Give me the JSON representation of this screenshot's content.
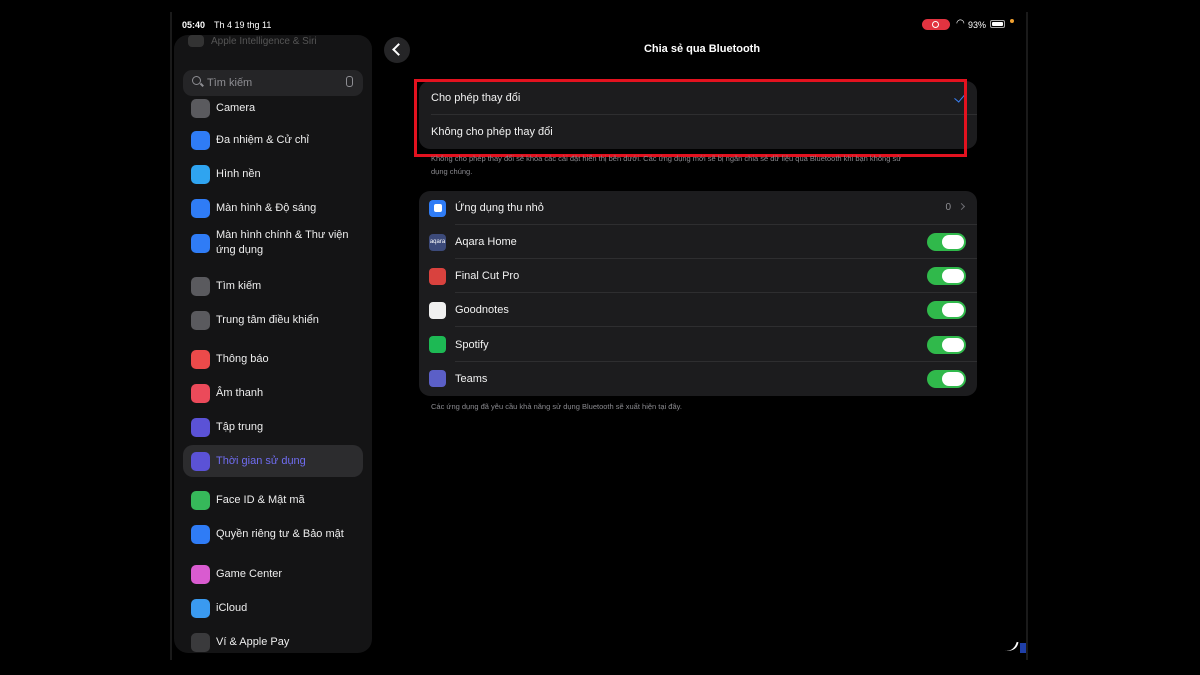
{
  "status_bar": {
    "time": "05:40",
    "date": "Th 4 19 thg 11",
    "battery": "93%"
  },
  "sidebar": {
    "faded_top": "Apple Intelligence & Siri",
    "search_placeholder": "Tìm kiếm",
    "items": [
      {
        "label": "Camera",
        "icon": "camera-icon",
        "color": "#5a5a5e"
      },
      {
        "label": "Đa nhiệm & Cử chỉ",
        "icon": "multitasking-icon",
        "color": "#2f7cf6"
      },
      {
        "label": "Hình nền",
        "icon": "wallpaper-icon",
        "color": "#2fa4f0"
      },
      {
        "label": "Màn hình & Độ sáng",
        "icon": "display-icon",
        "color": "#2f7cf6"
      },
      {
        "label": "Màn hình chính & Thư viện ứng dụng",
        "icon": "home-screen-icon",
        "color": "#2f7cf6"
      },
      {
        "label": "Tìm kiếm",
        "icon": "search-icon",
        "color": "#5a5a5e"
      },
      {
        "label": "Trung tâm điều khiển",
        "icon": "control-center-icon",
        "color": "#5a5a5e"
      },
      {
        "label": "Thông báo",
        "icon": "notifications-icon",
        "color": "#eb4a4a"
      },
      {
        "label": "Âm thanh",
        "icon": "sound-icon",
        "color": "#eb4a5a"
      },
      {
        "label": "Tập trung",
        "icon": "focus-icon",
        "color": "#5b52d6"
      },
      {
        "label": "Thời gian sử dụng",
        "icon": "screen-time-icon",
        "color": "#5b52d6",
        "active": true
      },
      {
        "label": "Face ID & Mật mã",
        "icon": "face-id-icon",
        "color": "#36b85a"
      },
      {
        "label": "Quyền riêng tư & Bảo mật",
        "icon": "privacy-hand-icon",
        "color": "#2f7cf6"
      },
      {
        "label": "Game Center",
        "icon": "game-center-icon",
        "color": "#d95bd0"
      },
      {
        "label": "iCloud",
        "icon": "icloud-icon",
        "color": "#3a9af0"
      },
      {
        "label": "Ví & Apple Pay",
        "icon": "wallet-icon",
        "color": "#3a3a3c"
      }
    ]
  },
  "main": {
    "title": "Chia sẻ qua Bluetooth",
    "options": [
      {
        "label": "Cho phép thay đổi",
        "selected": true
      },
      {
        "label": "Không cho phép thay đổi",
        "selected": false
      }
    ],
    "options_footnote_line1": "Không cho phép thay đổi sẽ khóa các cài đặt hiển thị bên dưới. Các ứng dụng mới sẽ bị ngăn chia sẻ dữ liệu qua Bluetooth khi bạn không sử",
    "options_footnote_line2": "dụng chúng.",
    "widgets_row": {
      "label": "Ứng dụng thu nhỏ",
      "count": "0"
    },
    "apps": [
      {
        "label": "Aqara Home",
        "icon": "aqara-home-icon",
        "icon_text": "aqara",
        "color": "#3c4a7a",
        "enabled": true
      },
      {
        "label": "Final Cut Pro",
        "icon": "final-cut-pro-icon",
        "icon_text": "",
        "color": "#d9423e",
        "enabled": true
      },
      {
        "label": "Goodnotes",
        "icon": "goodnotes-icon",
        "icon_text": "",
        "color": "#f0f0f0",
        "enabled": true
      },
      {
        "label": "Spotify",
        "icon": "spotify-icon",
        "icon_text": "",
        "color": "#1db954",
        "enabled": true
      },
      {
        "label": "Teams",
        "icon": "teams-icon",
        "icon_text": "",
        "color": "#5b5fc7",
        "enabled": true
      }
    ],
    "apps_footnote": "Các ứng dụng đã yêu cầu khả năng sử dụng Bluetooth sẽ xuất hiện tại đây."
  }
}
